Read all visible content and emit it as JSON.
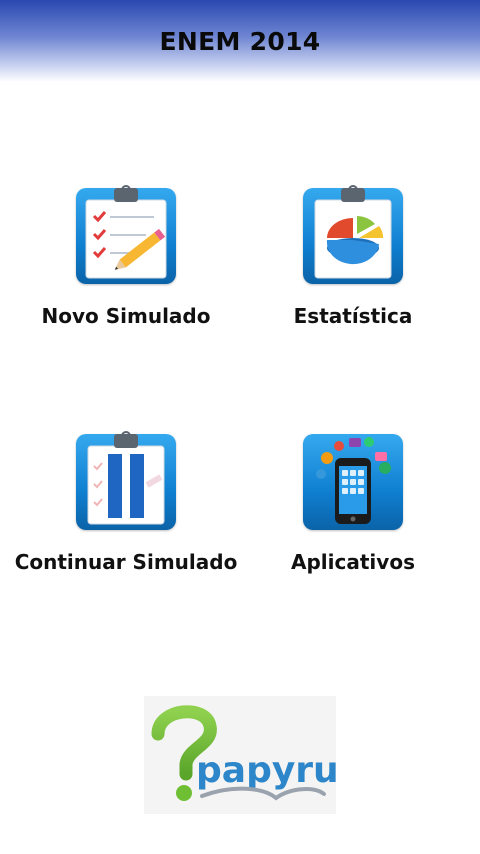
{
  "header": {
    "title": "ENEM 2014"
  },
  "menu": [
    {
      "label": "Novo Simulado",
      "icon": "clipboard-checklist-pencil-icon"
    },
    {
      "label": "Estatística",
      "icon": "clipboard-pie-chart-icon"
    },
    {
      "label": "Continuar Simulado",
      "icon": "clipboard-bars-icon"
    },
    {
      "label": "Aplicativos",
      "icon": "smartphone-apps-icon"
    }
  ],
  "brand": {
    "logo_text": "papyrus"
  },
  "colors": {
    "header_top": "#2a48b0",
    "icon_blue": "#1a8fe0",
    "logo_green": "#7dc242"
  }
}
